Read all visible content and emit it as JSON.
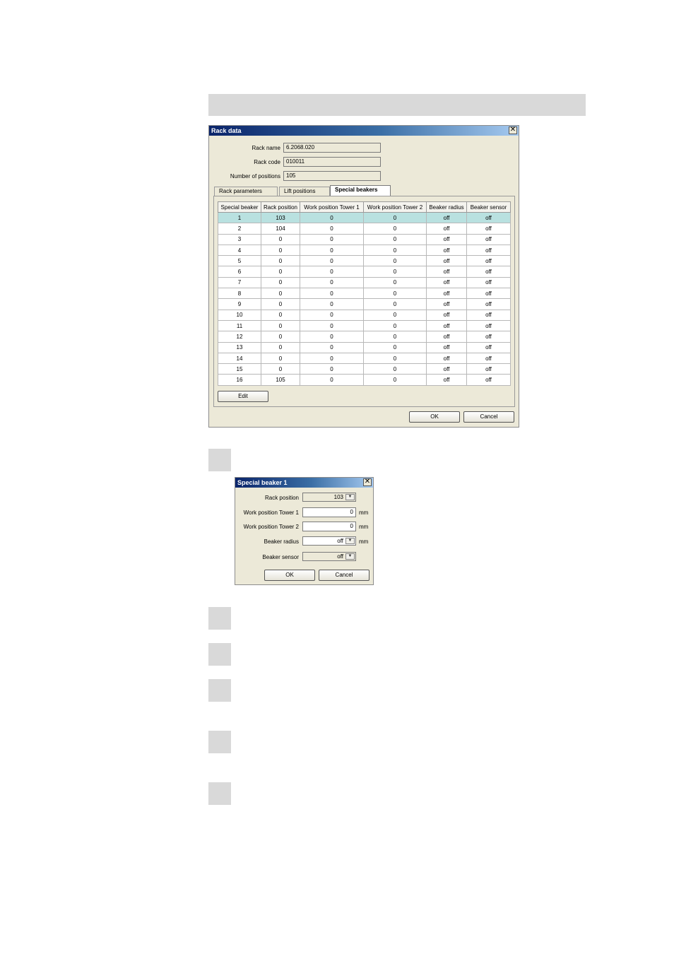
{
  "rack_dialog": {
    "title": "Rack data",
    "close": "✕",
    "fields": [
      {
        "label": "Rack name",
        "value": "6.2068.020"
      },
      {
        "label": "Rack code",
        "value": "010011"
      },
      {
        "label": "Number of positions",
        "value": "105"
      }
    ],
    "tabs": [
      "Rack parameters",
      "Lift positions",
      "Special beakers"
    ],
    "active_tab": "Special beakers",
    "table": {
      "columns": [
        "Special beaker",
        "Rack position",
        "Work position Tower 1",
        "Work position Tower 2",
        "Beaker radius",
        "Beaker sensor"
      ],
      "rows": [
        [
          "1",
          "103",
          "0",
          "0",
          "off",
          "off"
        ],
        [
          "2",
          "104",
          "0",
          "0",
          "off",
          "off"
        ],
        [
          "3",
          "0",
          "0",
          "0",
          "off",
          "off"
        ],
        [
          "4",
          "0",
          "0",
          "0",
          "off",
          "off"
        ],
        [
          "5",
          "0",
          "0",
          "0",
          "off",
          "off"
        ],
        [
          "6",
          "0",
          "0",
          "0",
          "off",
          "off"
        ],
        [
          "7",
          "0",
          "0",
          "0",
          "off",
          "off"
        ],
        [
          "8",
          "0",
          "0",
          "0",
          "off",
          "off"
        ],
        [
          "9",
          "0",
          "0",
          "0",
          "off",
          "off"
        ],
        [
          "10",
          "0",
          "0",
          "0",
          "off",
          "off"
        ],
        [
          "11",
          "0",
          "0",
          "0",
          "off",
          "off"
        ],
        [
          "12",
          "0",
          "0",
          "0",
          "off",
          "off"
        ],
        [
          "13",
          "0",
          "0",
          "0",
          "off",
          "off"
        ],
        [
          "14",
          "0",
          "0",
          "0",
          "off",
          "off"
        ],
        [
          "15",
          "0",
          "0",
          "0",
          "off",
          "off"
        ],
        [
          "16",
          "105",
          "0",
          "0",
          "off",
          "off"
        ]
      ],
      "selected_row": 0
    },
    "edit_label": "Edit",
    "ok_label": "OK",
    "cancel_label": "Cancel"
  },
  "beaker_dialog": {
    "title": "Special beaker 1",
    "close": "✕",
    "rack_position": {
      "label": "Rack position",
      "value": "103"
    },
    "work1": {
      "label": "Work position Tower 1",
      "value": "0",
      "unit": "mm"
    },
    "work2": {
      "label": "Work position Tower 2",
      "value": "0",
      "unit": "mm"
    },
    "radius": {
      "label": "Beaker radius",
      "value": "off",
      "unit": "mm"
    },
    "sensor": {
      "label": "Beaker sensor",
      "value": "off"
    },
    "ok_label": "OK",
    "cancel_label": "Cancel",
    "dropdown_icon": "chevron-down-icon"
  }
}
